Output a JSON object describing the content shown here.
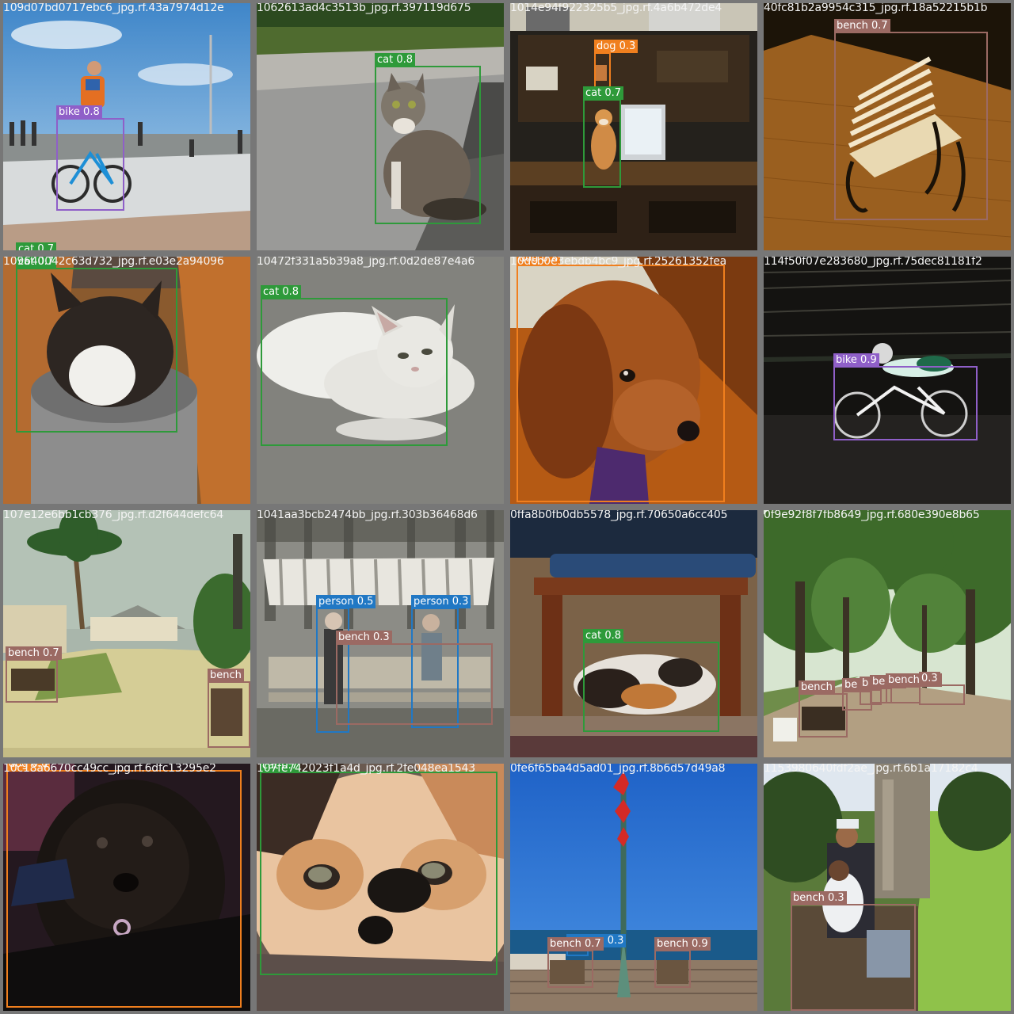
{
  "classes": {
    "bike": {
      "color": "#8f5fc8"
    },
    "cat": {
      "color": "#2e9a3a"
    },
    "dog": {
      "color": "#f07f1e"
    },
    "bench": {
      "color": "#9b6a63"
    },
    "person": {
      "color": "#2178c4"
    }
  },
  "tiles": [
    {
      "filename": "109d07bd0717ebc6_jpg.rf.43a7974d12e",
      "scene": "cyclist-promenade",
      "detections": [
        {
          "label": "bike 0.8",
          "cls": "bike"
        },
        {
          "label": "cat 0.7",
          "cls": "cat"
        }
      ]
    },
    {
      "filename": "1062613ad4c3513b_jpg.rf.397119d675",
      "scene": "cat-roadside",
      "detections": [
        {
          "label": "cat 0.8",
          "cls": "cat"
        }
      ]
    },
    {
      "filename": "1014e94f922325b5_jpg.rf.4a6b472de4",
      "scene": "cat-desk",
      "detections": [
        {
          "label": "dog 0.3",
          "cls": "dog"
        },
        {
          "label": "cat 0.7",
          "cls": "cat"
        }
      ]
    },
    {
      "filename": "40fc81b2a9954c315_jpg.rf.18a52215b1b",
      "scene": "bench-night",
      "detections": [
        {
          "label": "bench 0.7",
          "cls": "bench"
        }
      ]
    },
    {
      "filename": "109640042c63d732_jpg.rf.e03e2a94096",
      "scene": "cat-pot",
      "detections": [
        {
          "label": "cat 0.7",
          "cls": "cat"
        }
      ]
    },
    {
      "filename": "10472f331a5b39a8_jpg.rf.0d2de87e4a6",
      "scene": "white-cat",
      "detections": [
        {
          "label": "cat 0.8",
          "cls": "cat"
        }
      ]
    },
    {
      "filename": "10dcb0e3ebdb4bc9_jpg.rf.25261352fea",
      "scene": "dachshund",
      "detections": [
        {
          "label": "dog 0.8",
          "cls": "dog"
        }
      ]
    },
    {
      "filename": "114f50f07e283680_jpg.rf.75dec81181f2",
      "scene": "road-cyclist",
      "detections": [
        {
          "label": "bike 0.9",
          "cls": "bike"
        }
      ]
    },
    {
      "filename": "107e12e6bb1cb376_jpg.rf.d2f644defc64",
      "scene": "park-palms",
      "detections": [
        {
          "label": "bench 0.7",
          "cls": "bench"
        },
        {
          "label": "bench",
          "cls": "bench"
        }
      ]
    },
    {
      "filename": "1041aa3bcb2474bb_jpg.rf.303b36468d6",
      "scene": "swing-bench",
      "detections": [
        {
          "label": "person 0.5",
          "cls": "person"
        },
        {
          "label": "person 0.3",
          "cls": "person"
        },
        {
          "label": "bench 0.3",
          "cls": "bench"
        }
      ]
    },
    {
      "filename": "0ffa8b0fb0db5578_jpg.rf.70650a6cc405",
      "scene": "cat-under-table",
      "detections": [
        {
          "label": "cat 0.8",
          "cls": "cat"
        }
      ]
    },
    {
      "filename": "0f9e92f8f7fb8649_jpg.rf.680e390e8b65",
      "scene": "tree-avenue",
      "detections": [
        {
          "label": "bench",
          "cls": "bench"
        },
        {
          "label": "be",
          "cls": "bench"
        },
        {
          "label": "b",
          "cls": "bench"
        },
        {
          "label": "bench",
          "cls": "bench"
        },
        {
          "label": "bench 0.3",
          "cls": "bench"
        },
        {
          "label": "0.3",
          "cls": "bench"
        }
      ]
    },
    {
      "filename": "10c18a6670cc49cc_jpg.rf.6dfc13295e2",
      "scene": "black-dog",
      "detections": [
        {
          "label": "dog 0.6",
          "cls": "dog"
        }
      ]
    },
    {
      "filename": "107fe742023f1a4d_jpg.rf.2fe048ea1543",
      "scene": "kitten-face",
      "detections": [
        {
          "label": "cat 0.7",
          "cls": "cat"
        }
      ]
    },
    {
      "filename": "0fe6f65ba4d5ad01_jpg.rf.8b6d57d49a8",
      "scene": "seaside-pole",
      "detections": [
        {
          "label": "person 0.3",
          "cls": "person"
        },
        {
          "label": "bench 0.7",
          "cls": "bench"
        },
        {
          "label": "bench 0.9",
          "cls": "bench"
        }
      ]
    },
    {
      "filename": "1153980640fdf2ae_jpg.rf.6b1a17182c4",
      "scene": "park-bench-family",
      "detections": [
        {
          "label": "bench 0.3",
          "cls": "bench"
        }
      ]
    }
  ]
}
